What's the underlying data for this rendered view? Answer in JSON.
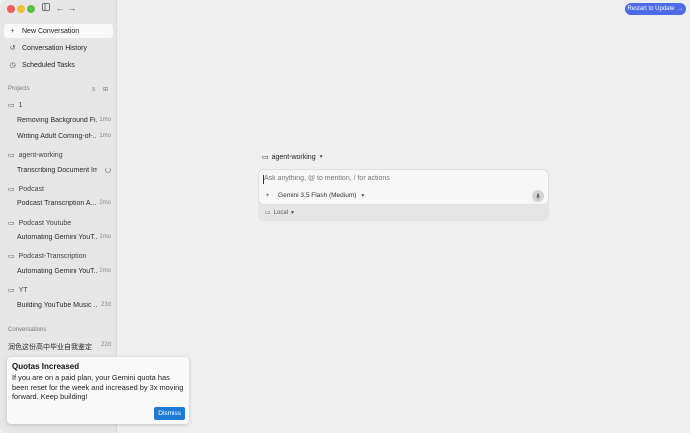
{
  "window": {
    "traffic_lights": [
      "close",
      "minimize",
      "zoom"
    ]
  },
  "titlebar": {
    "sidebar_toggle_icon": "sidebar-toggle-icon",
    "back_icon": "←",
    "forward_icon": "→"
  },
  "sidebar": {
    "nav": [
      {
        "label": "New Conversation",
        "icon": "+"
      },
      {
        "label": "Conversation History",
        "icon": "↺"
      },
      {
        "label": "Scheduled Tasks",
        "icon": "◷"
      }
    ],
    "projects_label": "Projects",
    "projects": [
      {
        "name": "1",
        "conversations": [
          {
            "title": "Removing Background Fi...",
            "age": "1mo"
          },
          {
            "title": "Writing Adult Coming-of-...",
            "age": "1mo"
          }
        ]
      },
      {
        "name": "agent-working",
        "conversations": [
          {
            "title": "Transcribing Document Im...",
            "age": ""
          }
        ]
      },
      {
        "name": "Podcast",
        "conversations": [
          {
            "title": "Podcast Transcription A...",
            "age": "2mo"
          }
        ]
      },
      {
        "name": "Podcast Youtube",
        "conversations": [
          {
            "title": "Automating Gemini YouT...",
            "age": "1mo"
          }
        ]
      },
      {
        "name": "Podcast-Transcription",
        "conversations": [
          {
            "title": "Automating Gemini YouT...",
            "age": "2mo"
          }
        ]
      },
      {
        "name": "YT",
        "conversations": [
          {
            "title": "Building YouTube Music ...",
            "age": "23d"
          }
        ]
      }
    ],
    "conversations_label": "Conversations",
    "conversations": [
      {
        "title": "润色这份高中毕业自我鉴定（...",
        "age": "22d"
      }
    ]
  },
  "toast": {
    "title": "Quotas Increased",
    "body": "If you are on a paid plan, your Gemini quota has been reset for the week and increased by 3x moving forward. Keep building!",
    "dismiss_label": "Dismiss"
  },
  "header": {
    "update_label": "Restart to Update",
    "update_arrow": "→"
  },
  "composer": {
    "workspace": "agent-working",
    "placeholder": "Ask anything, @ to mention, / for actions",
    "model": "Gemini 3.5 Flash (Medium)",
    "location": "Local"
  },
  "colors": {
    "accent": "#4b6ce6",
    "dismiss": "#1d7bd6",
    "sidebar_bg": "#e6e6e6",
    "main_bg": "#efefef"
  }
}
